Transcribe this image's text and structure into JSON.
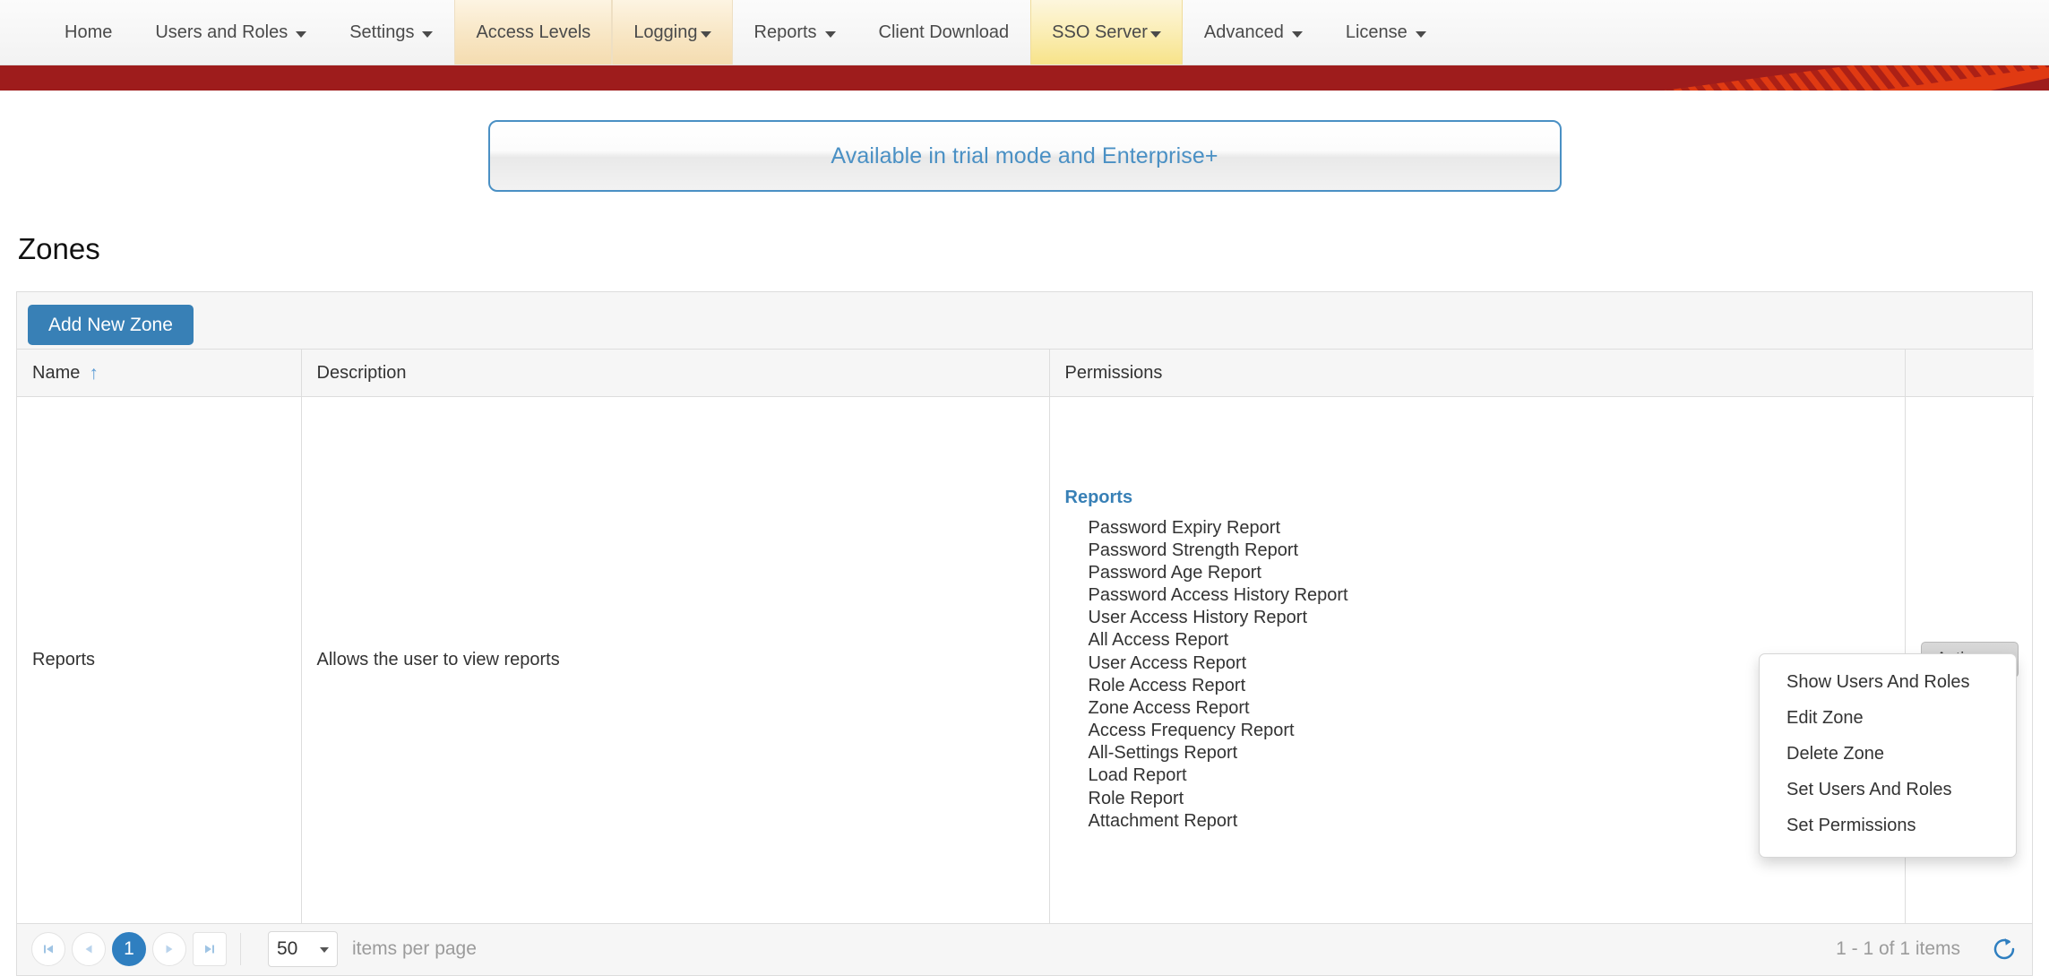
{
  "nav": {
    "items": [
      {
        "label": "Home",
        "caret": false,
        "state": "normal"
      },
      {
        "label": "Users and Roles",
        "caret": true,
        "state": "normal"
      },
      {
        "label": "Settings",
        "caret": true,
        "state": "normal"
      },
      {
        "label": "Access Levels",
        "caret": false,
        "state": "hovered"
      },
      {
        "label": "Logging",
        "caret": true,
        "state": "hovered"
      },
      {
        "label": "Reports",
        "caret": true,
        "state": "normal"
      },
      {
        "label": "Client Download",
        "caret": false,
        "state": "normal"
      },
      {
        "label": "SSO Server",
        "caret": true,
        "state": "active"
      },
      {
        "label": "Advanced",
        "caret": true,
        "state": "normal"
      },
      {
        "label": "License",
        "caret": true,
        "state": "normal"
      }
    ]
  },
  "banner": {
    "text": "Available in trial mode and Enterprise+",
    "border_color": "#4a90c4",
    "text_color": "#4a90c4"
  },
  "header_band": {
    "color": "#9e1c1c",
    "accent_color": "#e03a12"
  },
  "page": {
    "title": "Zones"
  },
  "toolbar": {
    "add_new_zone_label": "Add New Zone",
    "primary_color": "#3880b6"
  },
  "grid": {
    "columns": [
      {
        "label": "Name",
        "sorted": true,
        "sort_direction": "asc",
        "sort_glyph": "↑"
      },
      {
        "label": "Description",
        "sorted": false
      },
      {
        "label": "Permissions",
        "sorted": false
      },
      {
        "label": "",
        "sorted": false
      }
    ],
    "rows": [
      {
        "name": "Reports",
        "description": "Allows the user to view reports",
        "permission_group": "Reports",
        "permissions": [
          "Password Expiry Report",
          "Password Strength Report",
          "Password Age Report",
          "Password Access History Report",
          "User Access History Report",
          "All Access Report",
          "User Access Report",
          "Role Access Report",
          "Zone Access Report",
          "Access Frequency Report",
          "All-Settings Report",
          "Load Report",
          "Role Report",
          "Attachment Report"
        ],
        "actions_label": "Actions"
      }
    ]
  },
  "actions_menu": {
    "open": true,
    "items": [
      "Show Users And Roles",
      "Edit Zone",
      "Delete Zone",
      "Set Users And Roles",
      "Set Permissions"
    ]
  },
  "pager": {
    "first_icon": "⏮",
    "prev_icon": "◀",
    "next_icon": "▶",
    "last_icon": "⏭",
    "current_page": "1",
    "page_size": "50",
    "items_per_page_label": "items per page",
    "range_label": "1 - 1 of 1 items",
    "refresh_icon": "refresh-icon",
    "accent_color": "#2f7fc0"
  }
}
